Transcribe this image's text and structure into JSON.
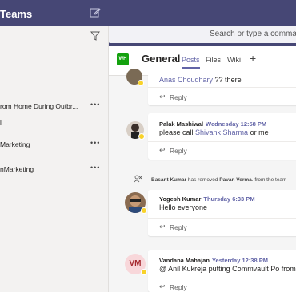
{
  "app": {
    "title": "Teams"
  },
  "search": {
    "placeholder": "Search or type a command"
  },
  "sidebar": {
    "items": [
      {
        "label": "rom Home During Outbr...",
        "more": "•••"
      },
      {
        "label": "l",
        "more": ""
      },
      {
        "label": "Marketing",
        "more": "•••"
      },
      {
        "label": "nMarketing",
        "more": "•••"
      }
    ]
  },
  "channel": {
    "badge": "WH",
    "name": "General",
    "tabs": [
      "Posts",
      "Files",
      "Wiki"
    ],
    "add_tab": "+"
  },
  "messages": [
    {
      "text_mention": "Anas Choudhary",
      "text_rest": " ?? there",
      "reply": "Reply"
    },
    {
      "author": "Palak Mashiwal",
      "time": "Wednesday 12:58 PM",
      "text_pre": "please call ",
      "mention": "Shivank Sharma",
      "text_post": " or me",
      "reply": "Reply"
    },
    {
      "system_actor": "Basant Kumar",
      "system_text": " has removed ",
      "system_target": "Pavan Verma",
      "system_rest": ". from the team"
    },
    {
      "author": "Yogesh Kumar",
      "time": "Thursday 6:33 PM",
      "text": "Hello everyone",
      "reply": "Reply"
    },
    {
      "author": "Vandana Mahajan",
      "time": "Yesterday 12:38 PM",
      "text": "@ Anil Kukreja putting Commvault Po from H",
      "initials": "VM",
      "reply": "Reply"
    }
  ],
  "colors": {
    "topbar": "#464775",
    "accent": "#6264a7",
    "team_badge": "#13a10e",
    "presence": "#f8d22a"
  }
}
